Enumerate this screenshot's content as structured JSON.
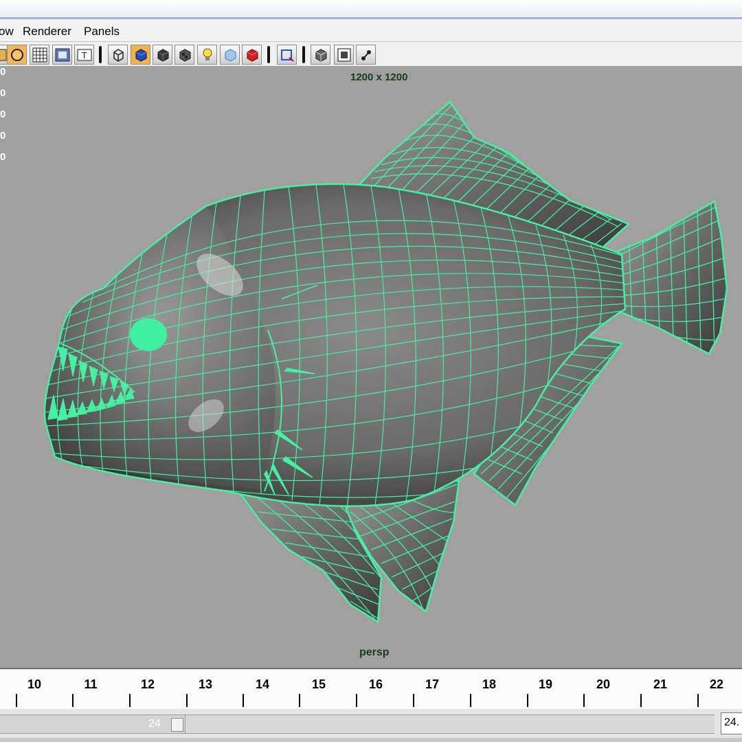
{
  "menubar": {
    "items": [
      {
        "label": "ow"
      },
      {
        "label": "Renderer"
      },
      {
        "label": "Panels"
      }
    ]
  },
  "toolbar": {
    "icons": [
      "camera-attribute-icon",
      "film-gate-icon",
      "grid-icon",
      "resolution-gate-icon",
      "field-chart-icon",
      "wireframe-cube-icon",
      "smooth-shade-icon",
      "flat-shade-icon",
      "texture-icon",
      "lighting-icon",
      "shadow-icon",
      "render-icon",
      "isolate-select-icon",
      "xray-icon",
      "wireframe-on-shaded-icon",
      "joint-xray-icon"
    ]
  },
  "viewport": {
    "resolution_label": "1200 x 1200",
    "camera_label": "persp",
    "hud_left_values": [
      "0",
      "0",
      "0",
      "0",
      "0"
    ],
    "wire_color": "#46f0a0",
    "background_color": "#a0a0a0"
  },
  "timeline": {
    "frames": [
      "10",
      "11",
      "12",
      "13",
      "14",
      "15",
      "16",
      "17",
      "18",
      "19",
      "20",
      "21",
      "22"
    ]
  },
  "range_slider": {
    "start_value": "24",
    "end_field_value": "24."
  }
}
